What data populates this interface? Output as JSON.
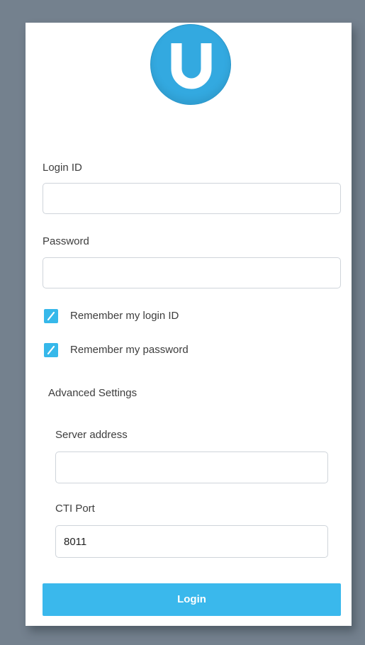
{
  "logo": {
    "letter": "U",
    "color": "#33a9e0"
  },
  "login_id": {
    "label": "Login ID",
    "value": "",
    "placeholder": ""
  },
  "password": {
    "label": "Password",
    "value": "",
    "placeholder": ""
  },
  "remember_login": {
    "label": "Remember my login ID",
    "checked": true
  },
  "remember_password": {
    "label": "Remember my password",
    "checked": true
  },
  "advanced": {
    "title": "Advanced Settings"
  },
  "server_address": {
    "label": "Server address",
    "value": "",
    "placeholder": ""
  },
  "cti_port": {
    "label": "CTI Port",
    "value": "8011",
    "placeholder": ""
  },
  "login_button": {
    "label": "Login",
    "color": "#3ab8ec"
  },
  "colors": {
    "background": "#74818e",
    "card": "#ffffff",
    "accent": "#36b8ea"
  }
}
